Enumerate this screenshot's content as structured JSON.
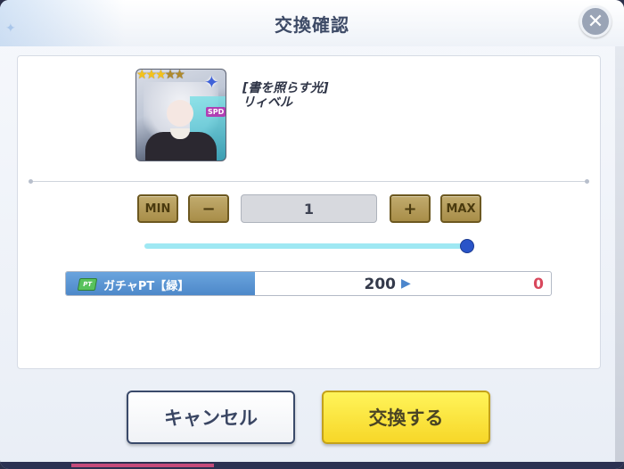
{
  "dialog": {
    "title": "交換確認",
    "close_icon": "close-icon",
    "close_glyph": "✕"
  },
  "item": {
    "name": "[書を照らす光]",
    "character": "リィベル",
    "stars_filled": 3,
    "stars_total": 5,
    "badge": "SPD",
    "rank_icon": "sparkle-rank-icon"
  },
  "quantity": {
    "min_label": "MIN",
    "minus_label": "−",
    "value": "1",
    "plus_label": "+",
    "max_label": "MAX",
    "slider_fraction": 1.0
  },
  "cost": {
    "icon": "gacha-ticket-icon",
    "label": "ガチャPT【緑】",
    "amount": "200",
    "remaining": "0",
    "arrow": "▶"
  },
  "buttons": {
    "cancel": "キャンセル",
    "confirm": "交換する"
  },
  "colors": {
    "accent_blue": "#4b86c8",
    "confirm_yellow": "#f7d728",
    "remaining_red": "#d8475c",
    "step_button_gold": "#a88d48"
  }
}
